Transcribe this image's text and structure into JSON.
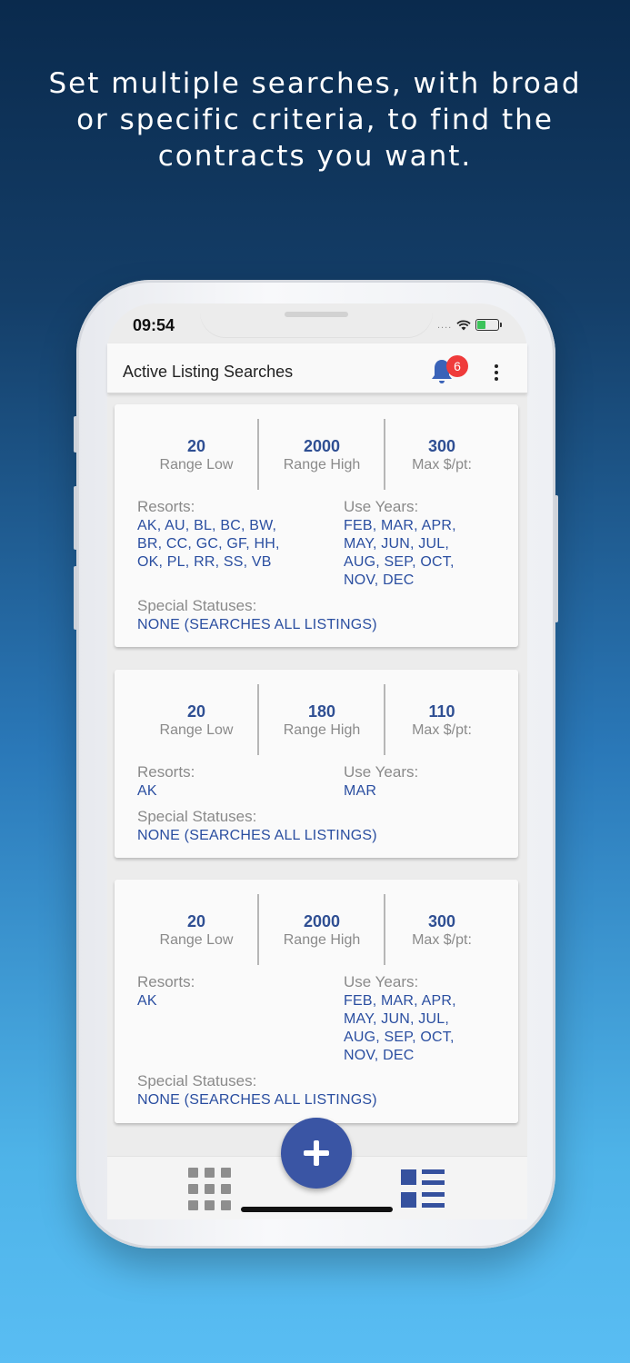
{
  "headline": {
    "line1": "Set multiple searches, with broad",
    "line2": "or specific criteria, to find the",
    "line3": "contracts you want."
  },
  "status_bar": {
    "time": "09:54",
    "signal": "....",
    "icons": [
      "wifi-icon",
      "battery-charging-icon"
    ]
  },
  "app_bar": {
    "title": "Active Listing Searches",
    "notification_count": "6",
    "icons": [
      "bell-icon",
      "more-vert-icon"
    ]
  },
  "labels": {
    "range_low": "Range Low",
    "range_high": "Range High",
    "max_per_point": "Max $/pt:",
    "resorts": "Resorts:",
    "use_years": "Use Years:",
    "special_statuses": "Special Statuses:"
  },
  "searches": [
    {
      "range_low": "20",
      "range_high": "2000",
      "max_per_point": "300",
      "resorts": [
        "AK, AU, BL, BC, BW,",
        "BR, CC, GC, GF, HH,",
        "OK, PL, RR, SS, VB"
      ],
      "use_years": [
        "FEB, MAR, APR,",
        "MAY, JUN, JUL,",
        "AUG, SEP, OCT,",
        "NOV, DEC"
      ],
      "special_statuses": "NONE (SEARCHES ALL LISTINGS)"
    },
    {
      "range_low": "20",
      "range_high": "180",
      "max_per_point": "110",
      "resorts": [
        "AK"
      ],
      "use_years": [
        "MAR"
      ],
      "special_statuses": "NONE (SEARCHES ALL LISTINGS)"
    },
    {
      "range_low": "20",
      "range_high": "2000",
      "max_per_point": "300",
      "resorts": [
        "AK"
      ],
      "use_years": [
        "FEB, MAR, APR,",
        "MAY, JUN, JUL,",
        "AUG, SEP, OCT,",
        "NOV, DEC"
      ],
      "special_statuses": "NONE (SEARCHES ALL LISTINGS)"
    }
  ],
  "bottom_nav": {
    "icons": [
      "grid-view-icon",
      "add-icon",
      "list-view-icon"
    ]
  },
  "colors": {
    "accent": "#3a55a4",
    "value_text": "#2a4ea0",
    "badge": "#ef3b3b"
  }
}
